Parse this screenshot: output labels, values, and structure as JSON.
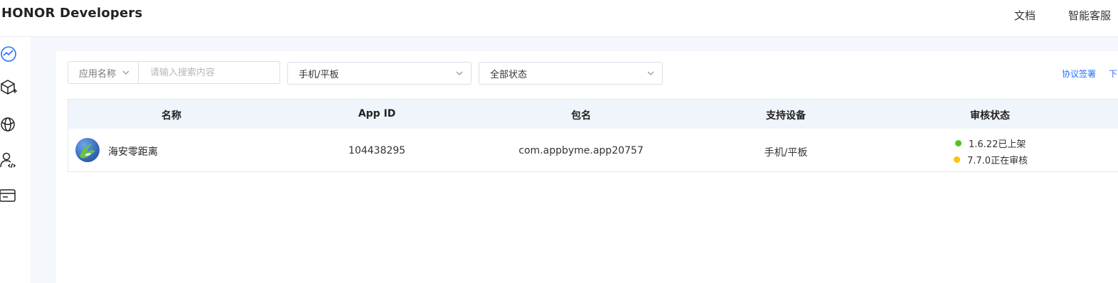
{
  "header": {
    "brand": "HONOR Developers",
    "nav": [
      "文档",
      "智能客服"
    ]
  },
  "sidebar": {
    "icons": [
      "analytics-icon",
      "cube-add-icon",
      "globe-icon",
      "developer-user-icon",
      "card-icon"
    ]
  },
  "filters": {
    "field_select": "应用名称",
    "search_placeholder": "请输入搜索内容",
    "device_select": "手机/平板",
    "status_select": "全部状态"
  },
  "links": {
    "agreement": "协议签署",
    "next_partial": "下"
  },
  "table": {
    "headers": [
      "名称",
      "App ID",
      "包名",
      "支持设备",
      "审核状态"
    ],
    "rows": [
      {
        "name": "海安零距离",
        "app_id": "104438295",
        "package": "com.appbyme.app20757",
        "devices": "手机/平板",
        "statuses": [
          {
            "text": "1.6.22已上架",
            "color": "#52c41a"
          },
          {
            "text": "7.7.0正在审核",
            "color": "#fac20a"
          }
        ]
      }
    ]
  },
  "colors": {
    "accent": "#256fff",
    "header_bg": "#f0f4fb",
    "page_bg": "#f4f7fc"
  }
}
